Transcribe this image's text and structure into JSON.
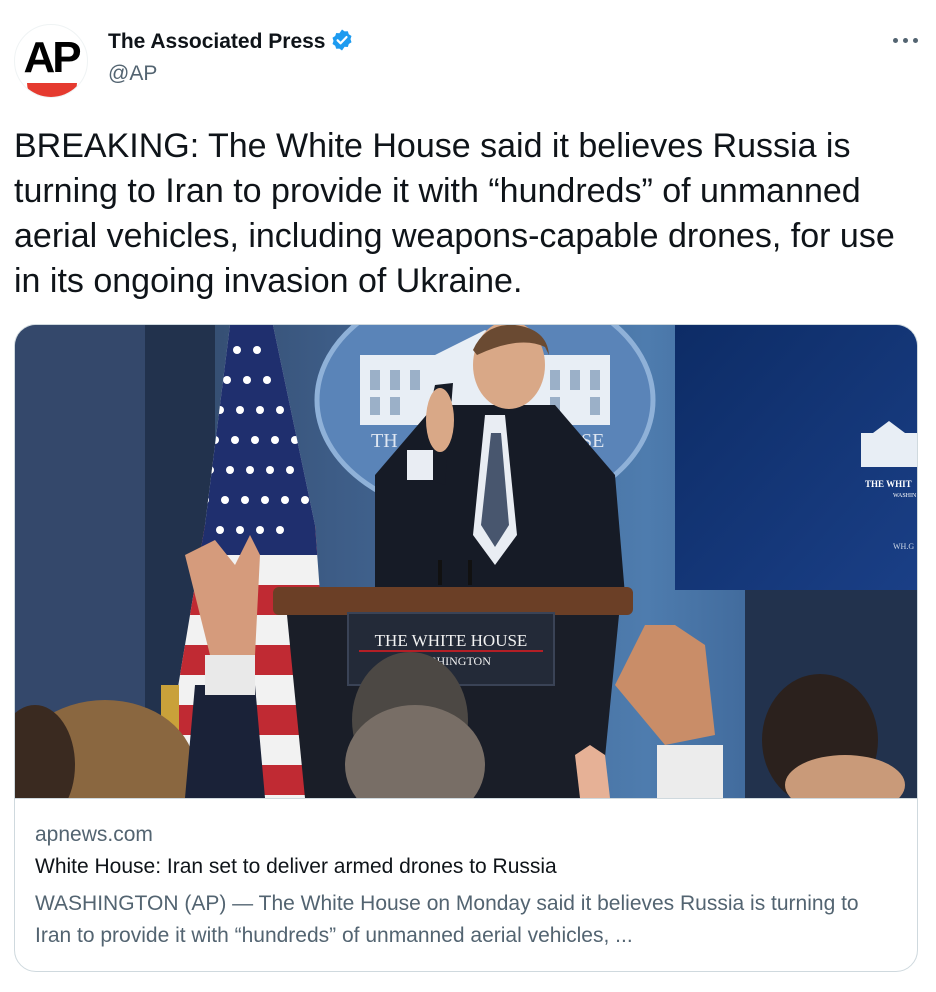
{
  "author": {
    "name": "The Associated Press",
    "handle": "@AP",
    "avatar_text": "AP",
    "verified": true
  },
  "icons": [
    "verified-badge-icon",
    "more-options-icon"
  ],
  "tweet": {
    "text": "BREAKING: The White House said it believes Russia is turning to Iran to provide it with “hundreds” of unmanned aerial vehicles, including weapons-capable drones, for use in its ongoing invasion of Ukraine."
  },
  "card": {
    "domain": "apnews.com",
    "title": "White House: Iran set to deliver armed drones to Russia",
    "description": "WASHINGTON (AP) — The White House on Monday said it believes Russia is turning to Iran to provide it with “hundreds” of unmanned aerial vehicles, ...",
    "photo": {
      "podium_line1": "THE WHITE HOUSE",
      "podium_line2": "WASHINGTON",
      "screen_line1": "THE WHIT",
      "screen_line2": "WASHIN",
      "screen_line3": "WH.G",
      "seal_left": "TH",
      "seal_right": "SE"
    }
  },
  "colors": {
    "verified_blue": "#1d9bf0",
    "ap_red": "#e53a2f",
    "secondary_text": "#536471",
    "border": "#cfd9de"
  }
}
